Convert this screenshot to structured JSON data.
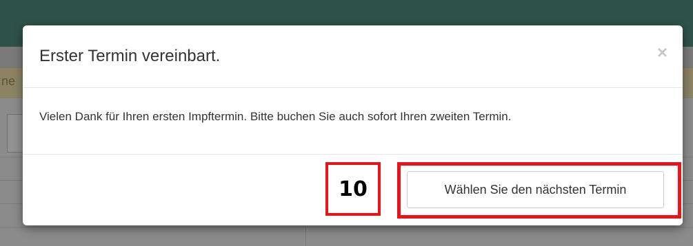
{
  "background": {
    "alert_partial_text": "ne"
  },
  "modal": {
    "title": "Erster Termin vereinbart.",
    "close_glyph": "×",
    "body_text": "Vielen Dank für Ihren ersten Impftermin. Bitte buchen Sie auch sofort Ihren zweiten Termin.",
    "next_button_label": "Wählen Sie den nächsten Termin"
  },
  "annotation": {
    "label": "10",
    "color": "#e8141a"
  },
  "colors": {
    "header": "#2f5248",
    "alert": "#8b8363",
    "overlay": "#8a8a8a"
  }
}
